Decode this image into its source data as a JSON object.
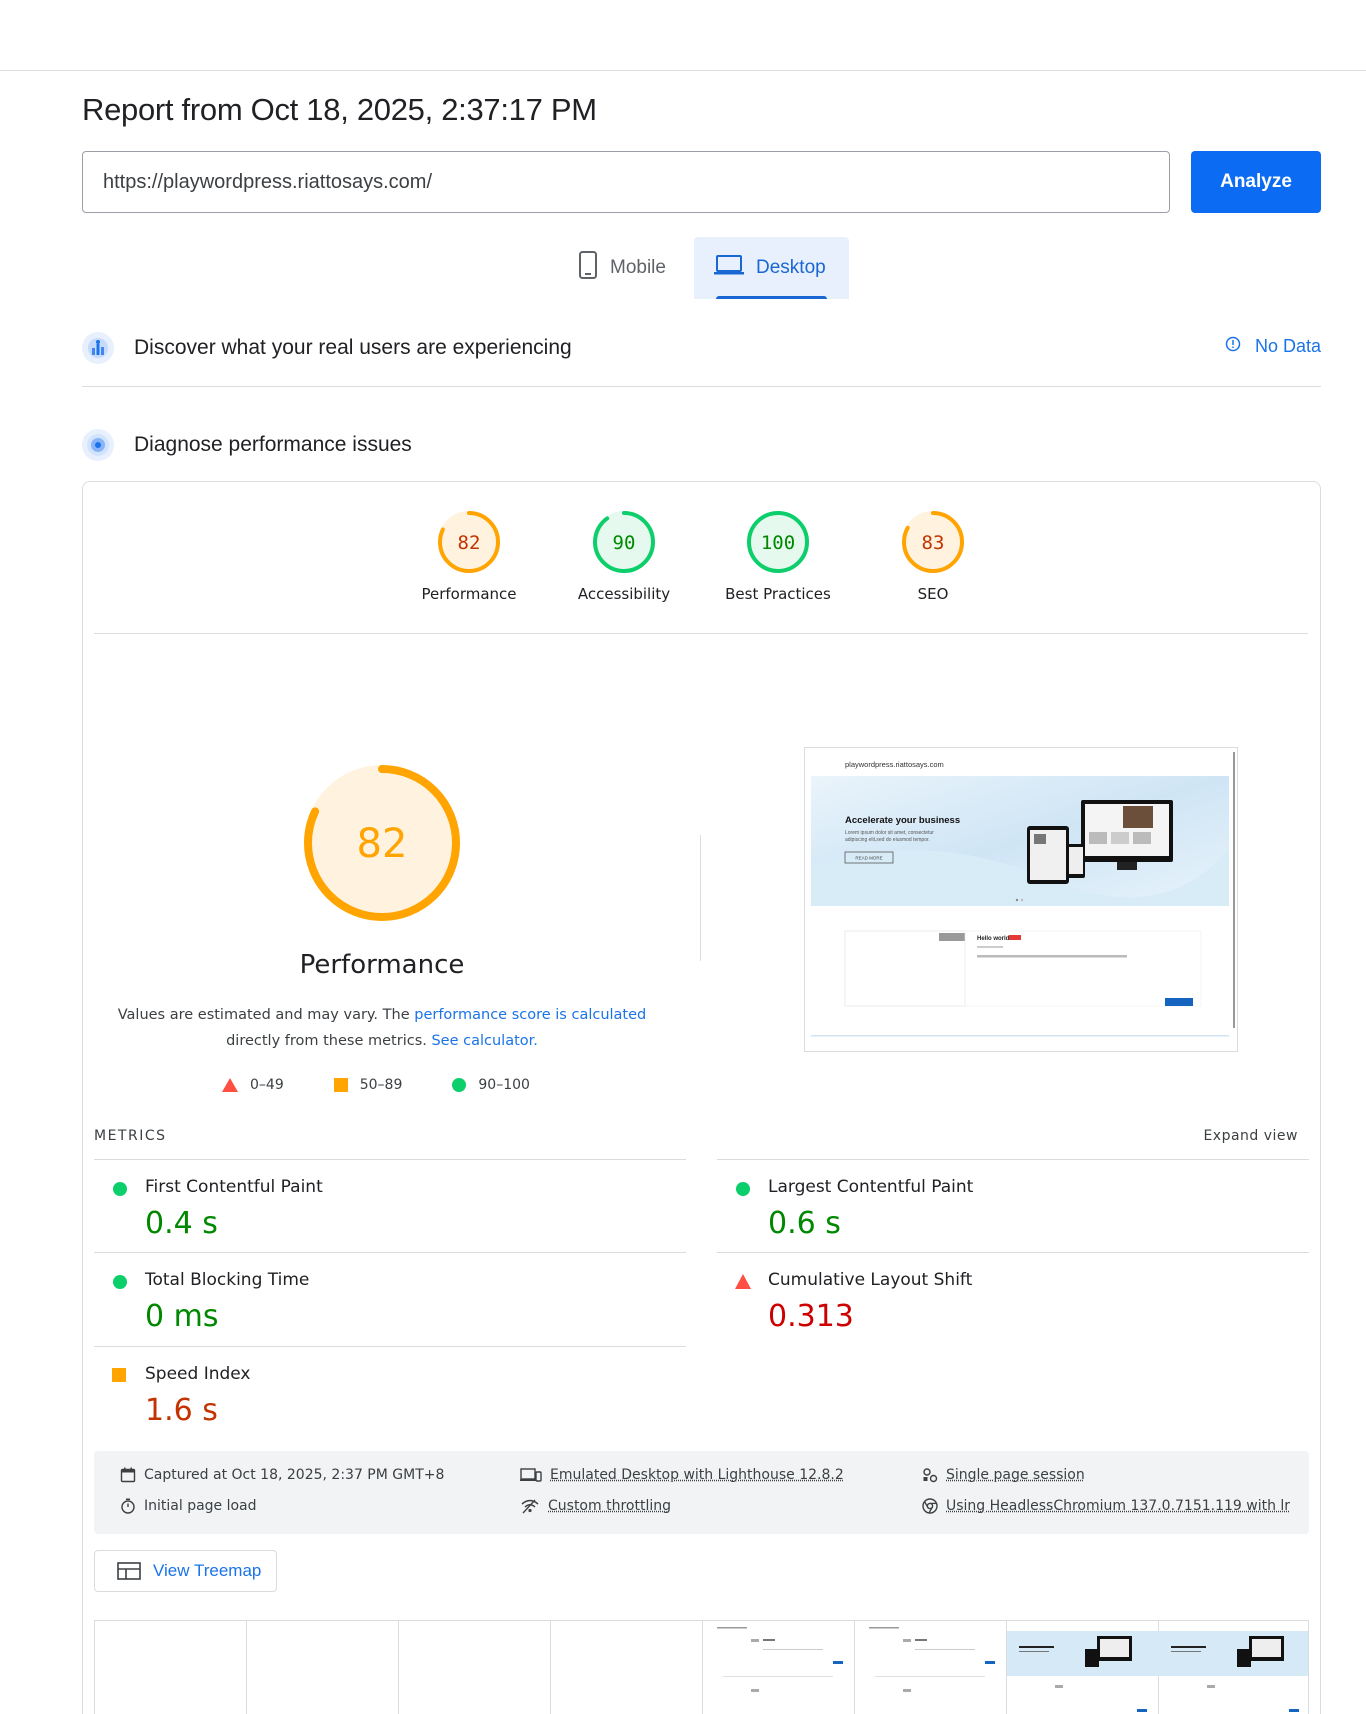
{
  "report": {
    "title": "Report from Oct 18, 2025, 2:37:17 PM",
    "url": "https://playwordpress.riattosays.com/",
    "analyze_label": "Analyze"
  },
  "tabs": [
    {
      "label": "Mobile",
      "active": false
    },
    {
      "label": "Desktop",
      "active": true
    }
  ],
  "real_users": {
    "title": "Discover what your real users are experiencing",
    "status": "No Data"
  },
  "diagnose": {
    "title": "Diagnose performance issues"
  },
  "categories": [
    {
      "label": "Performance",
      "score": 82,
      "rating": "average"
    },
    {
      "label": "Accessibility",
      "score": 90,
      "rating": "pass"
    },
    {
      "label": "Best Practices",
      "score": 100,
      "rating": "pass"
    },
    {
      "label": "SEO",
      "score": 83,
      "rating": "average"
    }
  ],
  "performance": {
    "score": "82",
    "score_value": 82,
    "title": "Performance",
    "desc_prefix": "Values are estimated and may vary. The ",
    "desc_link": "performance score is calculated",
    "desc_middle": "directly from these metrics.",
    "desc_link2": "See calculator.",
    "legend": {
      "fail": "0–49",
      "average": "50–89",
      "pass": "90–100"
    }
  },
  "screenshot": {
    "site_name": "playwordpress.riattosays.com",
    "hero_title": "Accelerate your business",
    "hero_text_1": "Lorem ipsum dolor sit amet, consectetur",
    "hero_text_2": "adipiscing elit,sed do eiusmod tempor.",
    "hero_button": "READ MORE",
    "post_title": "Hello world!"
  },
  "metrics": {
    "header": "METRICS",
    "expand": "Expand view",
    "items": [
      {
        "name": "First Contentful Paint",
        "value": "0.4 s",
        "rating": "pass"
      },
      {
        "name": "Largest Contentful Paint",
        "value": "0.6 s",
        "rating": "pass"
      },
      {
        "name": "Total Blocking Time",
        "value": "0 ms",
        "rating": "pass"
      },
      {
        "name": "Cumulative Layout Shift",
        "value": "0.313",
        "rating": "fail"
      },
      {
        "name": "Speed Index",
        "value": "1.6 s",
        "rating": "average"
      }
    ]
  },
  "info": {
    "captured": "Captured at Oct 18, 2025, 2:37 PM GMT+8",
    "page_load": "Initial page load",
    "emulated": "Emulated Desktop with Lighthouse 12.8.2",
    "throttling": "Custom throttling",
    "session": "Single page session",
    "browser": "Using HeadlessChromium 137.0.7151.119 with lr"
  },
  "treemap": {
    "label": "View Treemap"
  },
  "colors": {
    "pass": "#0cce6b",
    "pass_text": "#008800",
    "average": "#ffa400",
    "average_text": "#c33300",
    "fail": "#ff4e42",
    "fail_text": "#cc0000",
    "accent": "#1a73e8"
  }
}
